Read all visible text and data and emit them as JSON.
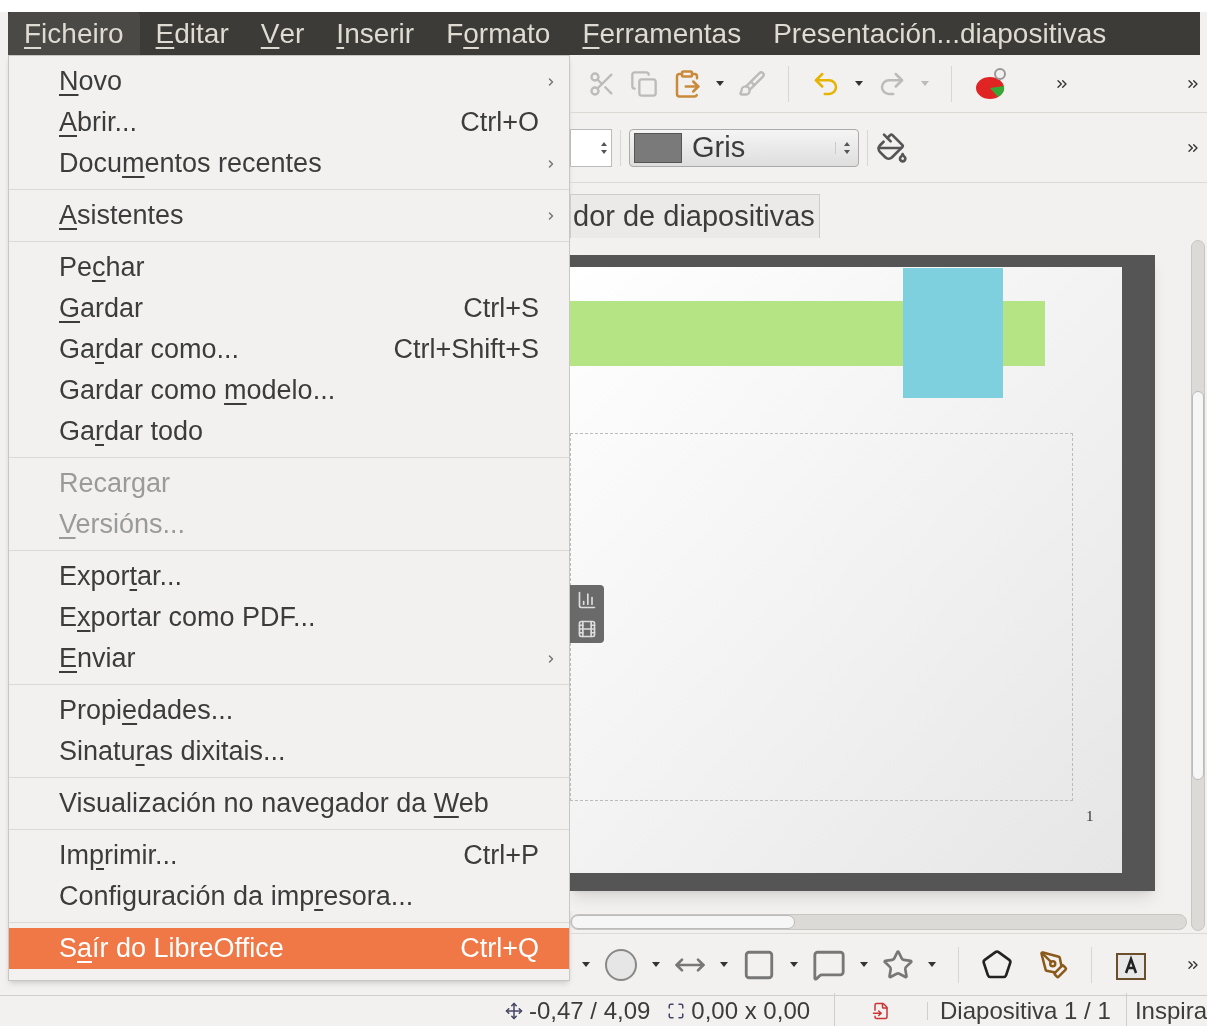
{
  "menubar": [
    {
      "label": {
        "key": "F",
        "after": "icheiro"
      },
      "selected": true
    },
    {
      "label": {
        "key": "E",
        "after": "ditar"
      },
      "selected": false
    },
    {
      "label": {
        "key": "V",
        "after": "er"
      },
      "selected": false
    },
    {
      "label": {
        "key": "I",
        "after": "nserir"
      },
      "selected": false
    },
    {
      "label": {
        "before": "F",
        "key": "o",
        "after": "rmato"
      },
      "selected": false
    },
    {
      "label": {
        "key": "F",
        "after": "erramentas"
      },
      "selected": false
    },
    {
      "label": {
        "before": "Presentación...diapositivas"
      },
      "selected": false
    }
  ],
  "file_menu": [
    [
      {
        "label": {
          "key": "N",
          "after": "ovo"
        },
        "submenu": true,
        "disabled": false,
        "selected": false
      },
      {
        "label": {
          "key": "A",
          "after": "brir..."
        },
        "shortcut": "Ctrl+O",
        "submenu": false,
        "disabled": false,
        "selected": false
      },
      {
        "label": {
          "before": "Docu",
          "key": "m",
          "after": "entos recentes"
        },
        "submenu": true,
        "disabled": false,
        "selected": false
      }
    ],
    [
      {
        "label": {
          "key": "A",
          "after": "sistentes"
        },
        "submenu": true,
        "disabled": false,
        "selected": false
      }
    ],
    [
      {
        "label": {
          "before": "Pe",
          "key": "c",
          "after": "har"
        },
        "submenu": false,
        "disabled": false,
        "selected": false
      },
      {
        "label": {
          "key": "G",
          "after": "ardar"
        },
        "shortcut": "Ctrl+S",
        "submenu": false,
        "disabled": false,
        "selected": false
      },
      {
        "label": {
          "before": "Ga",
          "key": "r",
          "after": "dar como..."
        },
        "shortcut": "Ctrl+Shift+S",
        "submenu": false,
        "disabled": false,
        "selected": false
      },
      {
        "label": {
          "before": "Gardar como ",
          "key": "m",
          "after": "odelo..."
        },
        "submenu": false,
        "disabled": false,
        "selected": false
      },
      {
        "label": {
          "before": "Ga",
          "key": "r",
          "after": "dar todo"
        },
        "submenu": false,
        "disabled": false,
        "selected": false
      }
    ],
    [
      {
        "label": {
          "before": "Recargar"
        },
        "submenu": false,
        "disabled": true,
        "selected": false
      },
      {
        "label": {
          "key": "V",
          "after": "ersións..."
        },
        "submenu": false,
        "disabled": true,
        "selected": false
      }
    ],
    [
      {
        "label": {
          "before": "Expor",
          "key": "t",
          "after": "ar..."
        },
        "submenu": false,
        "disabled": false,
        "selected": false
      },
      {
        "label": {
          "before": "E",
          "key": "x",
          "after": "portar como PDF..."
        },
        "submenu": false,
        "disabled": false,
        "selected": false
      },
      {
        "label": {
          "key": "E",
          "after": "nviar"
        },
        "submenu": true,
        "disabled": false,
        "selected": false
      }
    ],
    [
      {
        "label": {
          "before": "Propi",
          "key": "e",
          "after": "dades..."
        },
        "submenu": false,
        "disabled": false,
        "selected": false
      },
      {
        "label": {
          "before": "Sinatu",
          "key": "r",
          "after": "as dixitais..."
        },
        "submenu": false,
        "disabled": false,
        "selected": false
      }
    ],
    [
      {
        "label": {
          "before": "Visualización no navegador da ",
          "key": "W",
          "after": "eb"
        },
        "submenu": false,
        "disabled": false,
        "selected": false
      }
    ],
    [
      {
        "label": {
          "before": "Im",
          "key": "p",
          "after": "rimir..."
        },
        "shortcut": "Ctrl+P",
        "submenu": false,
        "disabled": false,
        "selected": false
      },
      {
        "label": {
          "before": "Configuración da imp",
          "key": "r",
          "after": "esora..."
        },
        "submenu": false,
        "disabled": false,
        "selected": false
      }
    ],
    [
      {
        "label": {
          "before": "S",
          "key": "a",
          "after": "ír do LibreOffice"
        },
        "shortcut": "Ctrl+Q",
        "submenu": false,
        "disabled": false,
        "selected": true
      }
    ]
  ],
  "toolbar": {
    "color_select": {
      "value": "Gris",
      "color": "#7a7a7a"
    }
  },
  "tab": {
    "label": "dor de diapositivas"
  },
  "slide": {
    "page_number": "1"
  },
  "status_bar": {
    "position": "-0,47 / 4,09",
    "size": "0,00 x 0,00",
    "slide": "Diapositiva 1 / 1",
    "design": "Inspira"
  }
}
